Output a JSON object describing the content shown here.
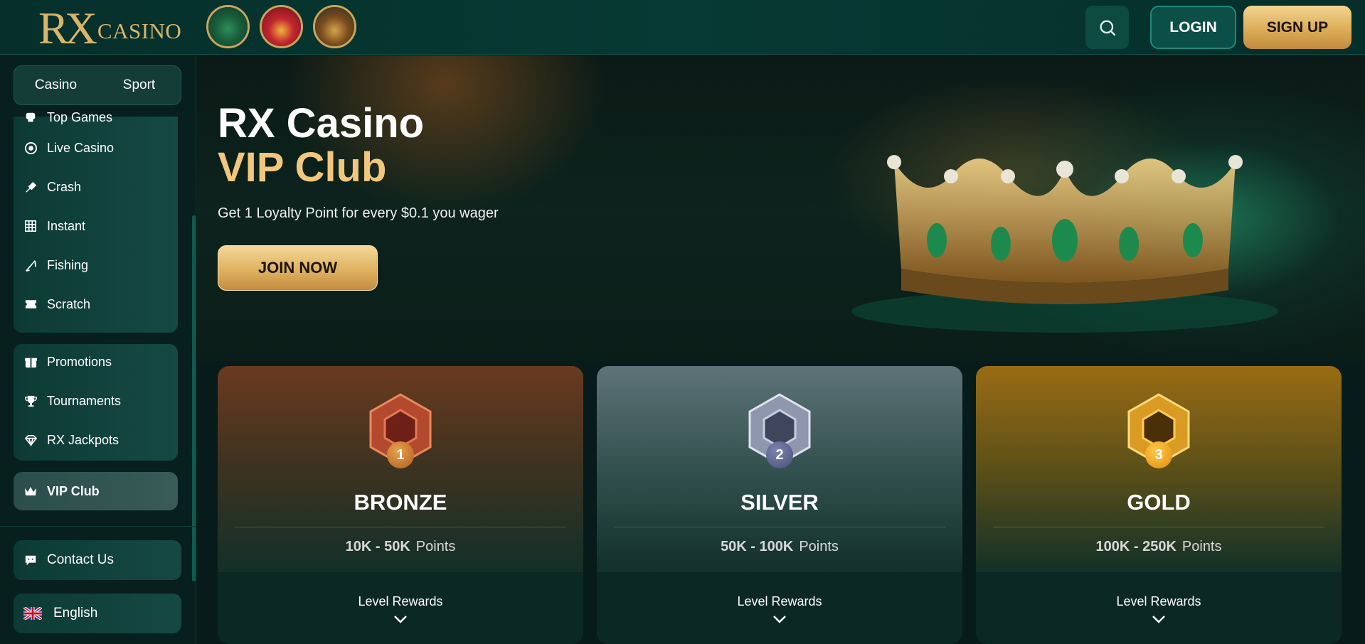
{
  "header": {
    "logo_rx": "RX",
    "logo_casino": "CASINO",
    "featured_games": [
      "green-gift-game-icon",
      "joker-game-icon",
      "treasure-chest-game-icon"
    ],
    "login_label": "LOGIN",
    "signup_label": "SIGN UP"
  },
  "sidebar": {
    "tabs": [
      "Casino",
      "Sport"
    ],
    "games_items": [
      {
        "label": "Top Games",
        "icon": "top-games-icon"
      },
      {
        "label": "Live Casino",
        "icon": "live-casino-icon"
      },
      {
        "label": "Crash",
        "icon": "crash-icon"
      },
      {
        "label": "Instant",
        "icon": "instant-icon"
      },
      {
        "label": "Fishing",
        "icon": "fishing-icon"
      },
      {
        "label": "Scratch",
        "icon": "scratch-icon"
      }
    ],
    "promo_items": [
      {
        "label": "Promotions",
        "icon": "promotions-icon"
      },
      {
        "label": "Tournaments",
        "icon": "trophy-icon"
      },
      {
        "label": "RX Jackpots",
        "icon": "diamond-icon"
      }
    ],
    "vip_item": {
      "label": "VIP Club",
      "icon": "crown-icon"
    },
    "contact_label": "Contact Us",
    "language_label": "English"
  },
  "hero": {
    "title_line1": "RX Casino",
    "title_line2": "VIP Club",
    "subtitle": "Get 1 Loyalty Point for every $0.1 you wager",
    "cta_label": "JOIN NOW"
  },
  "levels": [
    {
      "number": "1",
      "name": "BRONZE",
      "range": "10K - 50K",
      "unit": "Points",
      "rewards_label": "Level Rewards"
    },
    {
      "number": "2",
      "name": "SILVER",
      "range": "50K - 100K",
      "unit": "Points",
      "rewards_label": "Level Rewards"
    },
    {
      "number": "3",
      "name": "GOLD",
      "range": "100K - 250K",
      "unit": "Points",
      "rewards_label": "Level Rewards"
    }
  ],
  "colors": {
    "accent_gold": "#f1c77d",
    "primary_teal": "#0b4f47",
    "background": "#071c1a"
  }
}
